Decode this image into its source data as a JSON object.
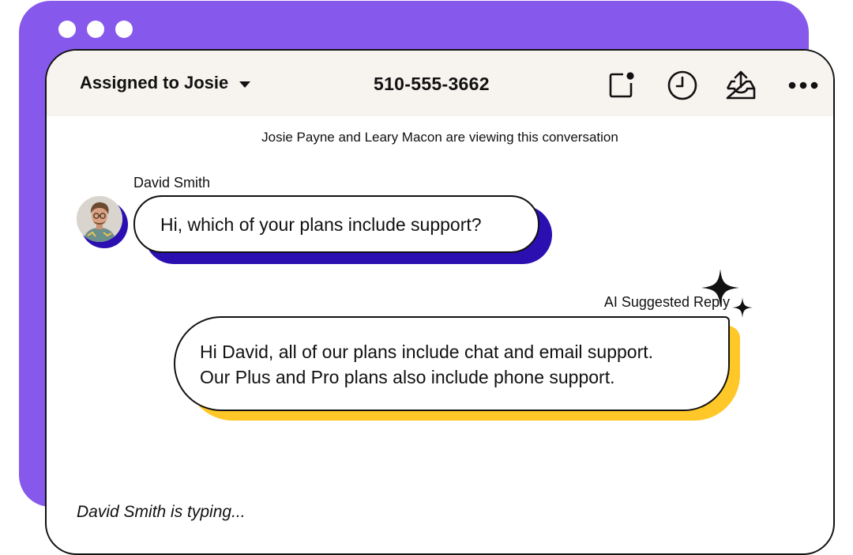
{
  "window": {
    "dot_count": 3
  },
  "header": {
    "assignment_label": "Assigned to Josie",
    "phone_number": "510-555-3662",
    "icons": [
      "note-icon",
      "clock-icon",
      "inbox-upload-icon",
      "more-icon"
    ]
  },
  "conversation": {
    "viewers_notice": "Josie Payne and Leary Macon are viewing this conversation",
    "incoming": {
      "sender_name": "David Smith",
      "message": "Hi, which of your plans include support?"
    },
    "suggested_reply": {
      "label": "AI Suggested Reply",
      "line1": "Hi David, all of our plans include chat and email support.",
      "line2": "Our Plus and Pro plans also include phone support."
    },
    "typing_indicator": "David Smith is typing..."
  },
  "colors": {
    "back_window": "#8659EC",
    "header_bg": "#F7F3EF",
    "incoming_shadow": "#2B0FB1",
    "reply_shadow": "#FFC828"
  }
}
